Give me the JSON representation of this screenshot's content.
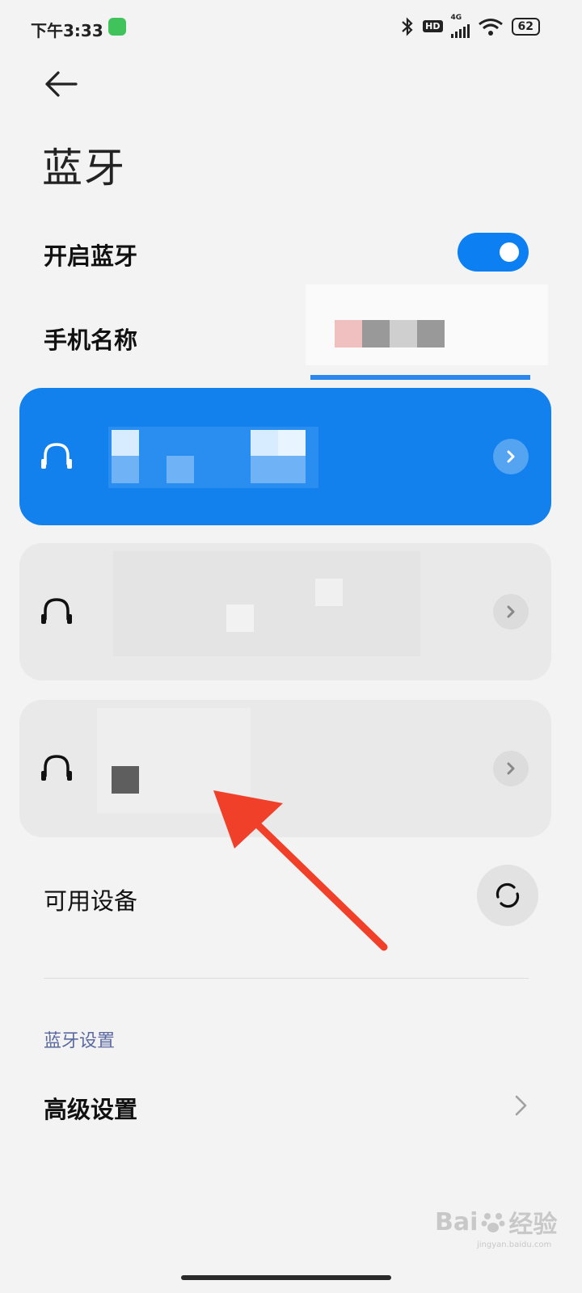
{
  "status_bar": {
    "time": "下午3:33",
    "network": "4G",
    "hd": "HD",
    "battery": "62"
  },
  "header": {
    "title": "蓝牙"
  },
  "bluetooth_toggle": {
    "label": "开启蓝牙",
    "state": "on",
    "accent": "#0c7ff2"
  },
  "phone_name": {
    "label": "手机名称"
  },
  "paired_devices": [
    {
      "icon": "headset-icon",
      "state": "connected"
    },
    {
      "icon": "headset-icon",
      "state": "paired"
    },
    {
      "icon": "headset-icon",
      "state": "paired"
    }
  ],
  "available": {
    "label": "可用设备"
  },
  "settings_section": {
    "label": "蓝牙设置",
    "items": [
      {
        "label": "高级设置"
      }
    ]
  },
  "watermark": {
    "brand": "Bai",
    "cn": "经验",
    "url": "jingyan.baidu.com"
  },
  "colors": {
    "accent": "#1281ee",
    "annotation_arrow": "#f0402a"
  }
}
